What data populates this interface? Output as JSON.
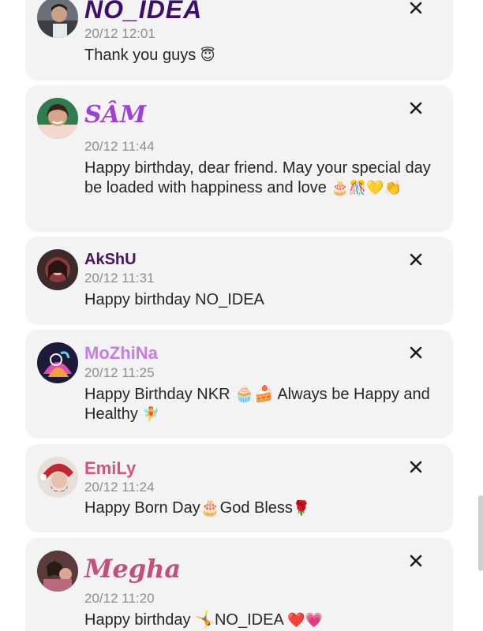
{
  "comments": [
    {
      "author": "NO_IDEA",
      "timestamp": "20/12 12:01",
      "text": "Thank you guys",
      "emoji": "😇",
      "author_color": "#3b0f6b"
    },
    {
      "author": "SÂM",
      "timestamp": "20/12 11:44",
      "text": "Happy birthday, dear friend. May your special day be loaded with happiness and love",
      "emoji": "🎂🎊💛👏",
      "author_color": "#a03fd6"
    },
    {
      "author": "AkShU",
      "timestamp": "20/12 11:31",
      "text": "Happy birthday NO_IDEA",
      "emoji": "",
      "author_color": "#4a1463"
    },
    {
      "author": "MoZhiNa",
      "timestamp": "20/12 11:25",
      "text": "Happy Birthday NKR 🧁🍰 Always be Happy and Healthy",
      "emoji": "🧚",
      "author_color": "#c77be8"
    },
    {
      "author": "EmiLy",
      "timestamp": "20/12 11:24",
      "text": "Happy Born Day🎂God Bless",
      "emoji": "🌹",
      "author_color": "#d9527a"
    },
    {
      "author": "Megha",
      "timestamp": "20/12 11:20",
      "text": "Happy birthday 🤸NO_IDEA",
      "emoji": "❤️💗",
      "author_color": "#c2507a"
    }
  ],
  "icons": {
    "close": "close-icon",
    "avatar": "avatar"
  },
  "colors": {
    "card_background": "#f3f3f3",
    "timestamp": "#8d8d8d",
    "text": "#262626"
  }
}
